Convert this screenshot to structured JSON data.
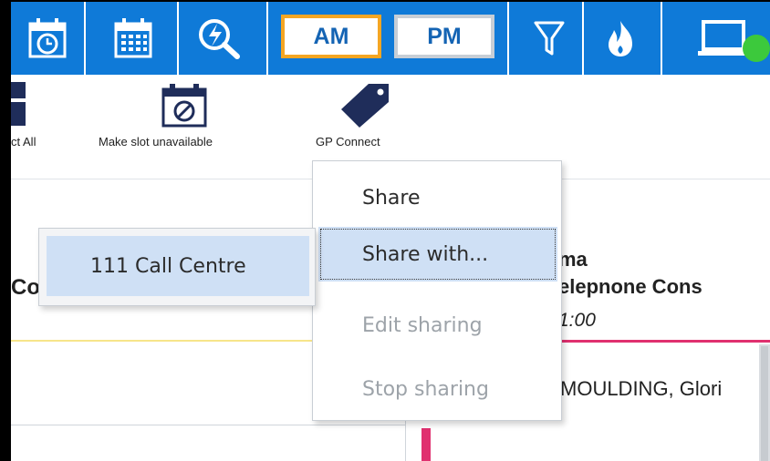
{
  "toolbar": {
    "am_label": "AM",
    "pm_label": "PM",
    "icons": [
      "clock-calendar-icon",
      "calendar-grid-icon",
      "quick-search-icon",
      "filter-icon",
      "flame-icon",
      "monitor-icon"
    ],
    "colors": {
      "background": "#0f7ad8",
      "am_border": "#f5a623",
      "pm_border": "#c7ced6",
      "status_online": "#3cc93c"
    }
  },
  "actions": {
    "select_all_partial": "ct All",
    "make_unavailable": "Make slot unavailable",
    "gp_connect": "GP Connect"
  },
  "background": {
    "left_header_partial": "Co",
    "right_header_partial": "ma",
    "right_subheader_partial": "elepnone Cons",
    "right_time_partial": "1:00",
    "patient_partial": "MOULDING, Glori"
  },
  "context_menu": {
    "items": [
      {
        "label": "Share",
        "state": "enabled"
      },
      {
        "label": "Share with...",
        "state": "highlighted"
      },
      {
        "label": "Edit sharing",
        "state": "disabled"
      },
      {
        "label": "Stop sharing",
        "state": "disabled"
      }
    ],
    "submenu": {
      "items": [
        {
          "label": "111 Call Centre"
        }
      ]
    }
  }
}
